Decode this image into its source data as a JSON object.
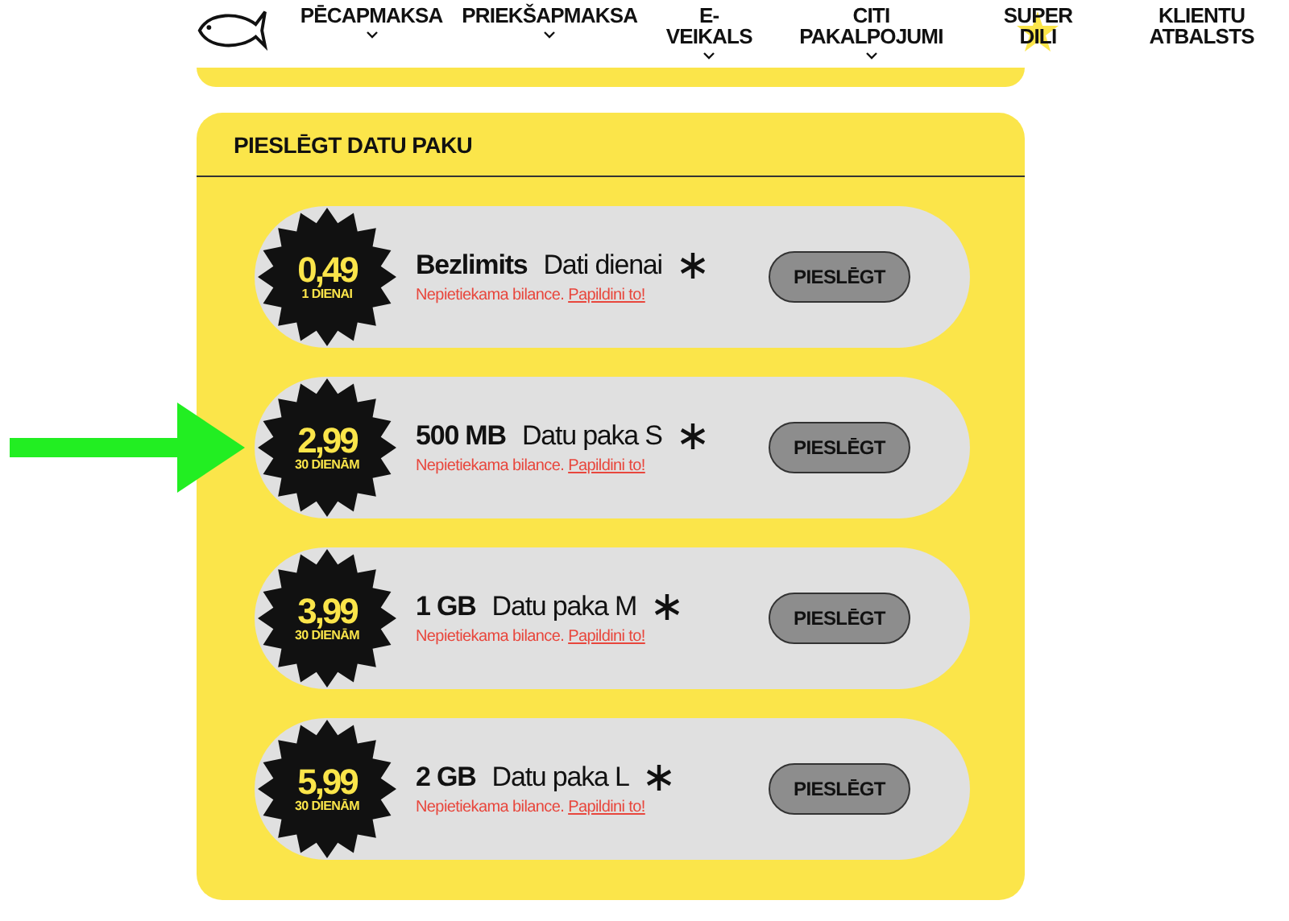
{
  "nav": {
    "items": [
      {
        "label": "PĒCAPMAKSA",
        "has_menu": true,
        "highlighted": false
      },
      {
        "label": "PRIEKŠAPMAKSA",
        "has_menu": true,
        "highlighted": false
      },
      {
        "label": "E-\nVEIKALS",
        "has_menu": true,
        "highlighted": false
      },
      {
        "label": "CITI\nPAKALPOJUMI",
        "has_menu": true,
        "highlighted": false
      },
      {
        "label": "SUPER\nDILI",
        "has_menu": false,
        "highlighted": true
      },
      {
        "label": "KLIENTU\nATBALSTS",
        "has_menu": false,
        "highlighted": false
      }
    ]
  },
  "card": {
    "title": "PIESLĒGT DATU PAKU",
    "packages": [
      {
        "price": "0,49",
        "period": "1 DIENAI",
        "size": "Bezlimits",
        "name": "Dati dienai",
        "note": "Nepietiekama bilance.",
        "link": "Papildini to!",
        "button": "PIESLĒGT",
        "pointed": false
      },
      {
        "price": "2,99",
        "period": "30 DIENĀM",
        "size": "500 MB",
        "name": "Datu paka S",
        "note": "Nepietiekama bilance.",
        "link": "Papildini to!",
        "button": "PIESLĒGT",
        "pointed": true
      },
      {
        "price": "3,99",
        "period": "30 DIENĀM",
        "size": "1 GB",
        "name": "Datu paka M",
        "note": "Nepietiekama bilance.",
        "link": "Papildini to!",
        "button": "PIESLĒGT",
        "pointed": false
      },
      {
        "price": "5,99",
        "period": "30 DIENĀM",
        "size": "2 GB",
        "name": "Datu paka L",
        "note": "Nepietiekama bilance.",
        "link": "Papildini to!",
        "button": "PIESLĒGT",
        "pointed": false
      }
    ]
  }
}
